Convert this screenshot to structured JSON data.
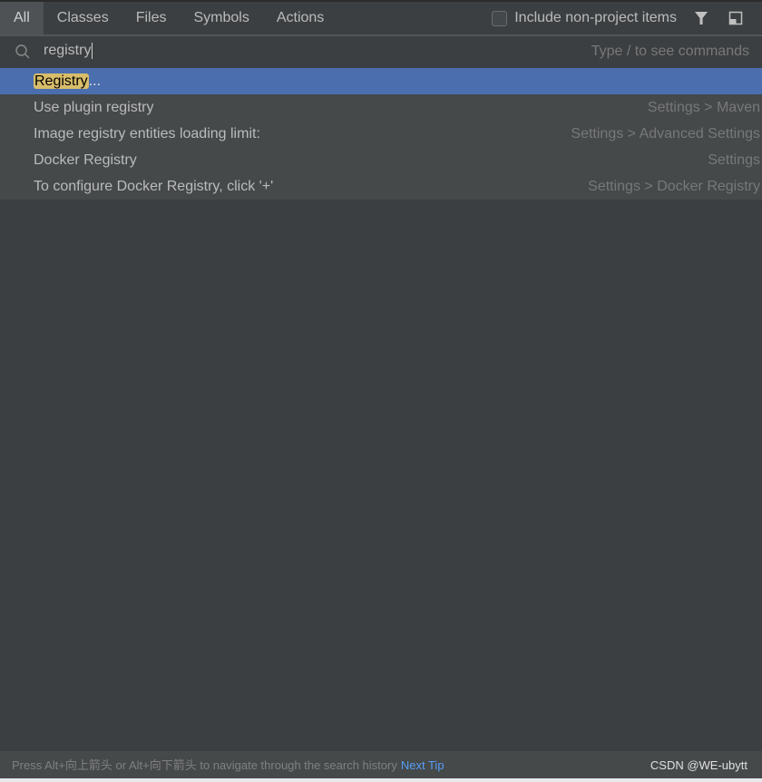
{
  "tabs": [
    {
      "label": "All",
      "active": true
    },
    {
      "label": "Classes"
    },
    {
      "label": "Files"
    },
    {
      "label": "Symbols"
    },
    {
      "label": "Actions"
    }
  ],
  "include_non_project": {
    "label": "Include non-project items",
    "checked": false
  },
  "icons": {
    "filter": "filter-icon",
    "preview": "preview-panel-icon",
    "search": "search-icon"
  },
  "search": {
    "value": "registry",
    "hint": "Type / to see commands"
  },
  "results": [
    {
      "match": "Registry",
      "rest": "...",
      "location": ""
    },
    {
      "name": "Use plugin registry",
      "location": "Settings > Maven"
    },
    {
      "name": "Image registry entities loading limit:",
      "location": "Settings > Advanced Settings"
    },
    {
      "name": "Docker Registry",
      "location": "Settings"
    },
    {
      "name": "To configure Docker Registry, click '+'",
      "location": "Settings > Docker Registry"
    }
  ],
  "footer": {
    "tip": "Press Alt+向上箭头 or Alt+向下箭头 to navigate through the search history",
    "next_tip": "Next Tip",
    "watermark": "CSDN @WE-ubytt"
  },
  "colors": {
    "selection": "#4b6eaf",
    "highlight": "#d8bd6a",
    "link": "#589df6"
  }
}
